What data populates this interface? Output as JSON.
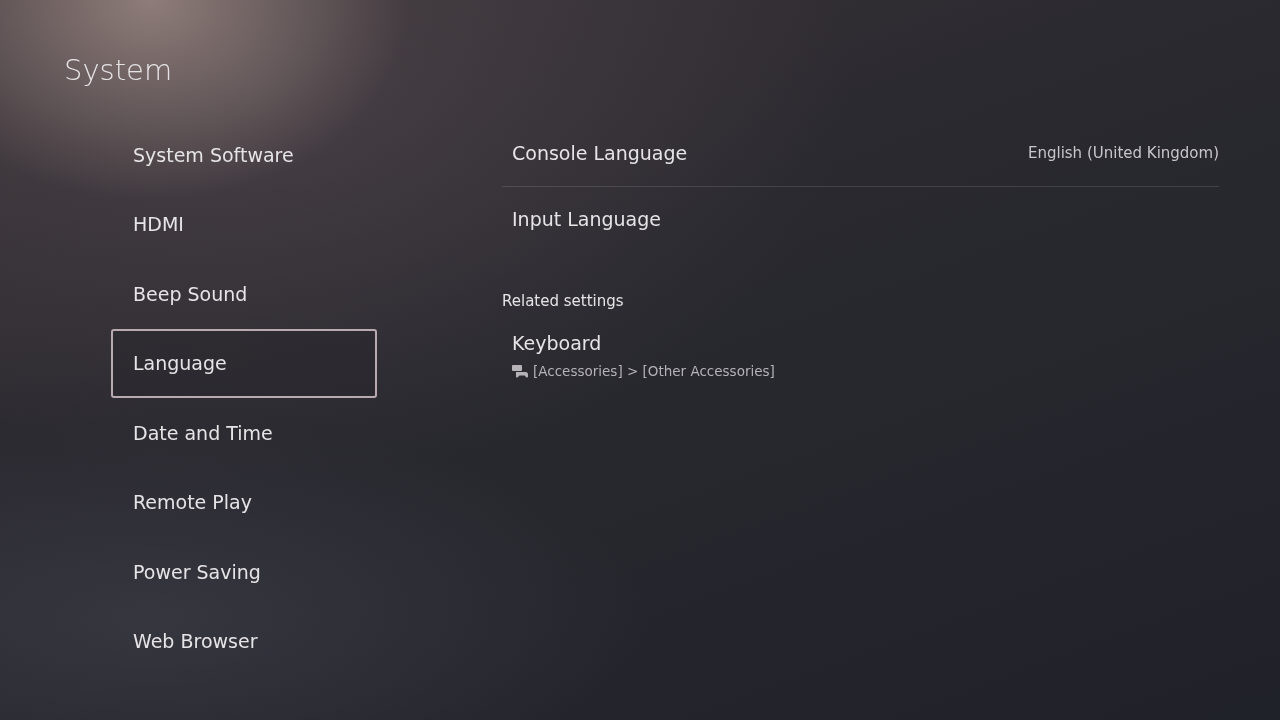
{
  "title": "System",
  "sidebar": {
    "items": [
      {
        "label": "System Software",
        "selected": false
      },
      {
        "label": "HDMI",
        "selected": false
      },
      {
        "label": "Beep Sound",
        "selected": false
      },
      {
        "label": "Language",
        "selected": true
      },
      {
        "label": "Date and Time",
        "selected": false
      },
      {
        "label": "Remote Play",
        "selected": false
      },
      {
        "label": "Power Saving",
        "selected": false
      },
      {
        "label": "Web Browser",
        "selected": false
      }
    ]
  },
  "settings": [
    {
      "label": "Console Language",
      "value": "English (United Kingdom)"
    },
    {
      "label": "Input Language"
    }
  ],
  "related": {
    "heading": "Related settings",
    "items": [
      {
        "label": "Keyboard",
        "path": "[Accessories] > [Other Accessories]"
      }
    ]
  }
}
